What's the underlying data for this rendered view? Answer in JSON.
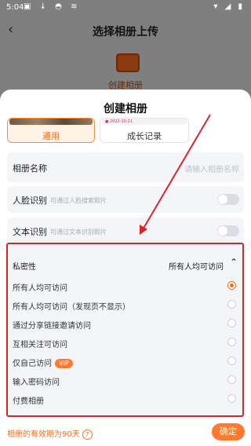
{
  "status_bar": {
    "time": "5:04",
    "icons_left": "▣ ↓ ◓ ≋",
    "icons_right": "▾ ◢ ▮"
  },
  "header": {
    "title": "选择相册上传"
  },
  "background": {
    "label": "创建相册"
  },
  "sheet": {
    "title": "创建相册",
    "templates": [
      {
        "label": "通用",
        "selected": true
      },
      {
        "label": "成长记录",
        "selected": false,
        "tiny": "● 2022-10-21"
      }
    ],
    "album_name": {
      "label": "相册名称",
      "placeholder": "请输入相册名称"
    },
    "face": {
      "label": "人脸识别",
      "hint": "可通过人脸搜索照片",
      "on": false
    },
    "text": {
      "label": "文本识别",
      "hint": "可通过文本识别照片",
      "on": false
    },
    "privacy": {
      "label": "私密性",
      "value": "所有人均可访问",
      "options": [
        {
          "label": "所有人均可访问",
          "selected": true
        },
        {
          "label": "所有人均可访问（发现页不显示）",
          "selected": false
        },
        {
          "label": "通过分享链接邀请访问",
          "selected": false
        },
        {
          "label": "互相关注可访问",
          "selected": false
        },
        {
          "label": "仅自己访问",
          "badge": "VIP",
          "selected": false
        },
        {
          "label": "输入密码访问",
          "selected": false
        },
        {
          "label": "付费相册",
          "selected": false
        }
      ]
    },
    "footer": {
      "validity": "相册的有效期为90天",
      "help": "?",
      "confirm": "确定"
    }
  },
  "colors": {
    "accent": "#ff6a1a",
    "highlight_border": "#d9242a"
  }
}
